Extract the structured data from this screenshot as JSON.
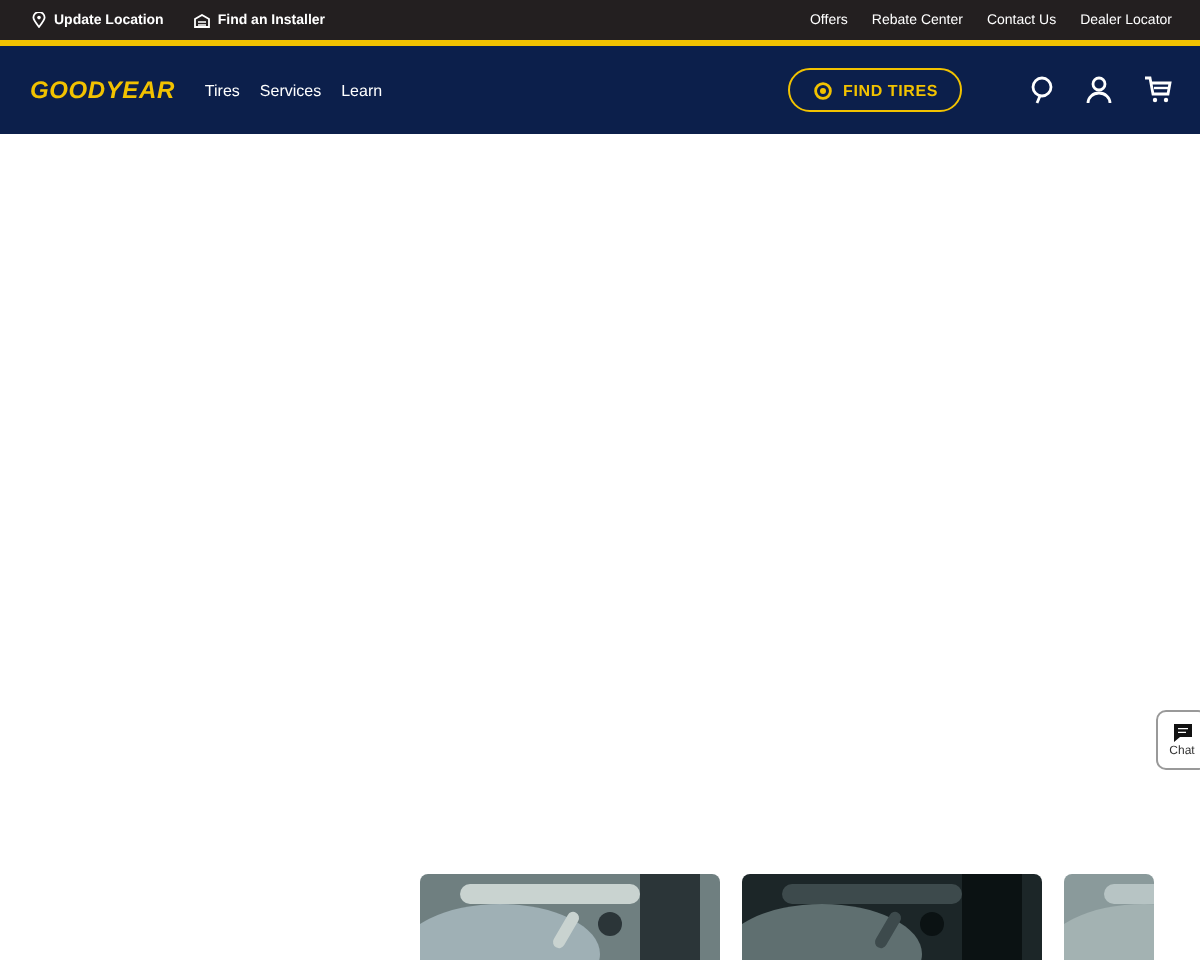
{
  "top_bar": {
    "left_links": [
      {
        "label": "Update Location",
        "kind": "location"
      },
      {
        "label": "Find an Installer",
        "kind": "installer"
      }
    ],
    "right_links": [
      "Offers",
      "Rebate Center",
      "Contact Us",
      "Dealer Locator"
    ]
  },
  "header": {
    "logo": "GOODYEAR",
    "nav": [
      "Tires",
      "Services",
      "Learn"
    ],
    "find_button": "FIND TIRES"
  },
  "chat": {
    "label": "Chat"
  }
}
